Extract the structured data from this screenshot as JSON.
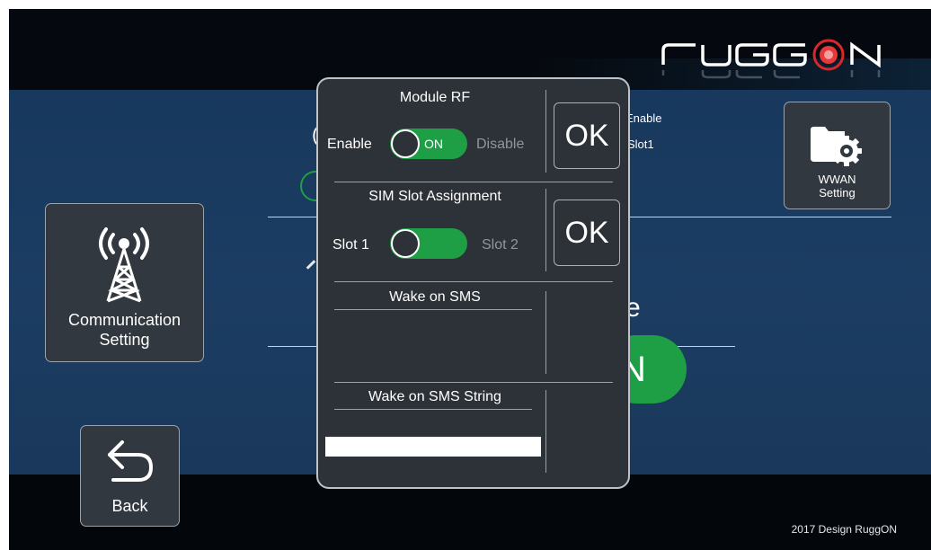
{
  "brand": {
    "logo_text": "RUGGON"
  },
  "footer": {
    "text": "2017 Design RuggON"
  },
  "communication_tile": {
    "label_line1": "Communication",
    "label_line2": "Setting"
  },
  "wwan_tile": {
    "label_line1": "WWAN",
    "label_line2": "Setting"
  },
  "back_tile": {
    "label": "Back"
  },
  "background": {
    "status_enable": "Enable",
    "status_slot": "Slot1",
    "partial_e": "e",
    "partial_on": "N"
  },
  "dialog": {
    "module_rf": {
      "title": "Module RF",
      "left_label": "Enable",
      "right_label": "Disable",
      "toggle_text": "ON",
      "toggle_state": "on",
      "ok_label": "OK"
    },
    "sim_slot": {
      "title": "SIM Slot Assignment",
      "left_label": "Slot 1",
      "right_label": "Slot 2",
      "toggle_state": "slot1",
      "ok_label": "OK"
    },
    "wake_on_sms": {
      "title": "Wake on SMS"
    },
    "wake_on_sms_string": {
      "title": "Wake on SMS String",
      "value": ""
    }
  },
  "colors": {
    "accent_green": "#1e9e45",
    "logo_red": "#d6282b",
    "panel_bg": "#2d3238"
  }
}
